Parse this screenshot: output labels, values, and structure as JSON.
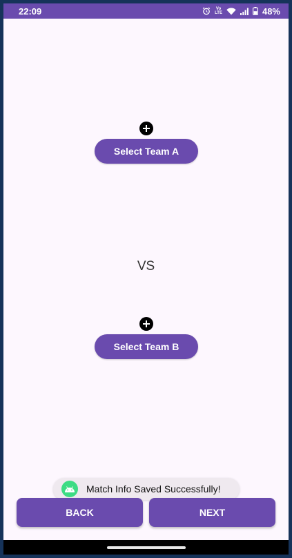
{
  "status_bar": {
    "time": "22:09",
    "battery": "48%",
    "icons": [
      "alarm-icon",
      "volte-icon",
      "wifi-icon",
      "signal-icon",
      "battery-icon"
    ],
    "volte_text": [
      "Vo",
      "LTE"
    ]
  },
  "teams": {
    "team_a_label": "Select Team A",
    "team_b_label": "Select Team B",
    "add_icon": "add-circle-icon",
    "vs": "VS"
  },
  "toast": {
    "message": "Match Info Saved Successfully!",
    "icon": "android-icon"
  },
  "nav": {
    "back_label": "BACK",
    "next_label": "NEXT"
  },
  "colors": {
    "primary": "#6a4bae",
    "background": "#fdf7fe",
    "toast_bg": "#efe9ef",
    "android_green": "#3ddc84"
  }
}
